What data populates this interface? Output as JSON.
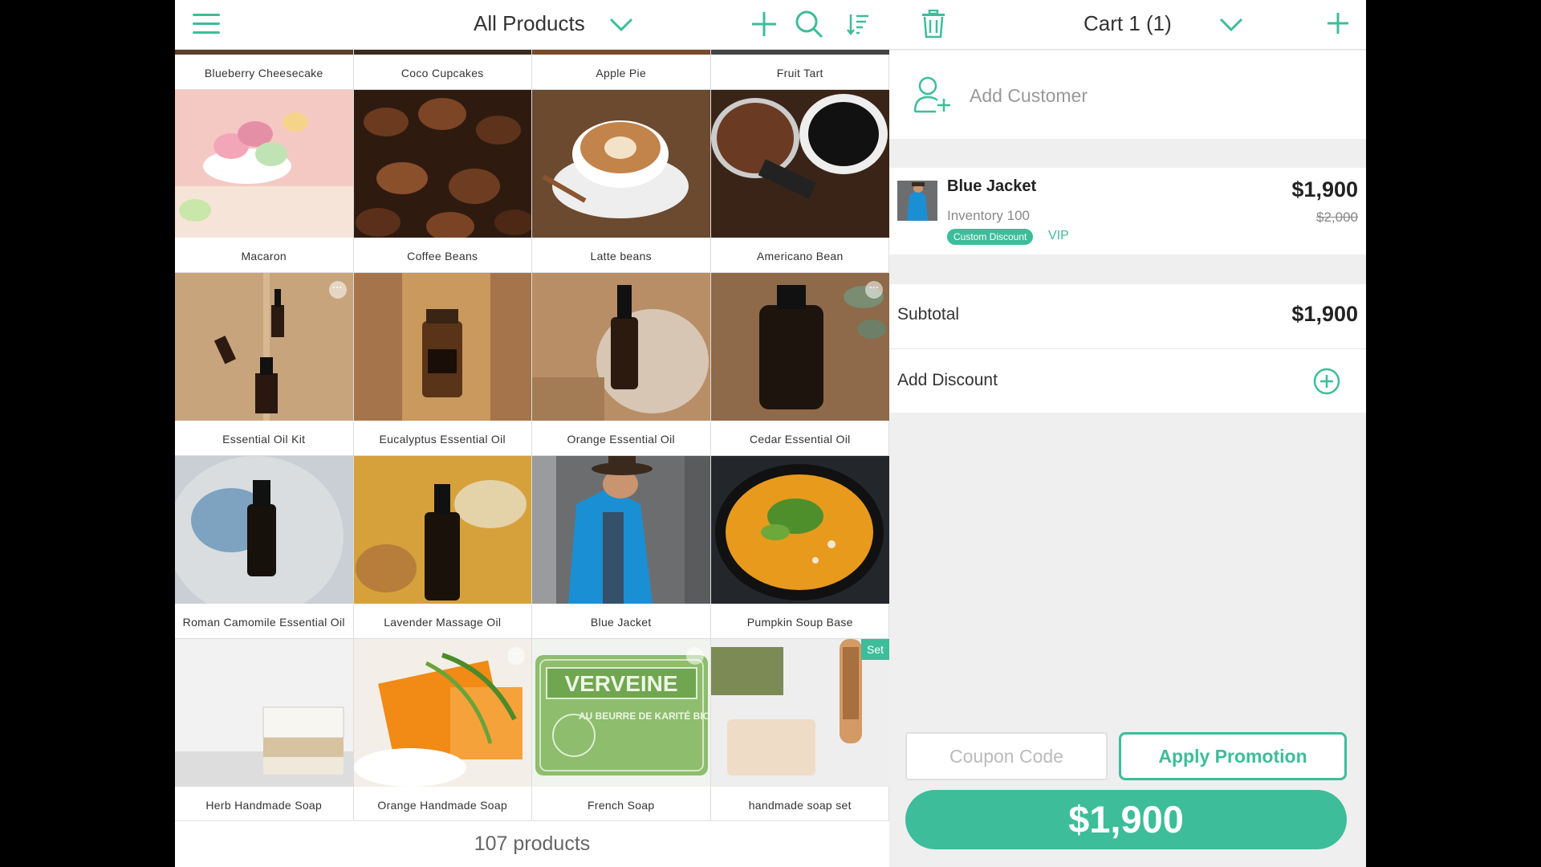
{
  "colors": {
    "accent": "#3dbd9a",
    "text": "#333333",
    "muted": "#999999"
  },
  "header": {
    "title": "All Products",
    "menu_icon": "hamburger-icon",
    "add_icon": "plus-icon",
    "search_icon": "search-icon",
    "sort_icon": "sort-icon"
  },
  "top_row": [
    "Blueberry Cheesecake",
    "Coco Cupcakes",
    "Apple Pie",
    "Fruit Tart"
  ],
  "products": [
    {
      "name": "Macaron"
    },
    {
      "name": "Coffee Beans"
    },
    {
      "name": "Latte beans"
    },
    {
      "name": "Americano Bean"
    },
    {
      "name": "Essential Oil Kit"
    },
    {
      "name": "Eucalyptus Essential Oil"
    },
    {
      "name": "Orange Essential Oil"
    },
    {
      "name": "Cedar Essential Oil"
    },
    {
      "name": "Roman Camomile Essential Oil"
    },
    {
      "name": "Lavender Massage Oil"
    },
    {
      "name": "Blue Jacket"
    },
    {
      "name": "Pumpkin Soup Base"
    },
    {
      "name": "Herb Handmade Soap"
    },
    {
      "name": "Orange Handmade Soap"
    },
    {
      "name": "French Soap",
      "image_text": "VERVEINE",
      "image_subtext": "AU BEURRE DE KARITÉ BIO"
    },
    {
      "name": "handmade soap set",
      "badge": "Set"
    }
  ],
  "more_glyph": "···",
  "footer": {
    "count": "107 products"
  },
  "cart": {
    "title": "Cart 1 (1)",
    "add_customer": "Add Customer",
    "item": {
      "name": "Blue Jacket",
      "inventory": "Inventory 100",
      "discount_tag": "Custom Discount",
      "vip": "VIP",
      "price": "$1,900",
      "original_price": "$2,000"
    },
    "subtotal_label": "Subtotal",
    "subtotal_value": "$1,900",
    "add_discount": "Add Discount",
    "coupon_placeholder": "Coupon Code",
    "apply_promotion": "Apply Promotion",
    "total": "$1,900"
  }
}
